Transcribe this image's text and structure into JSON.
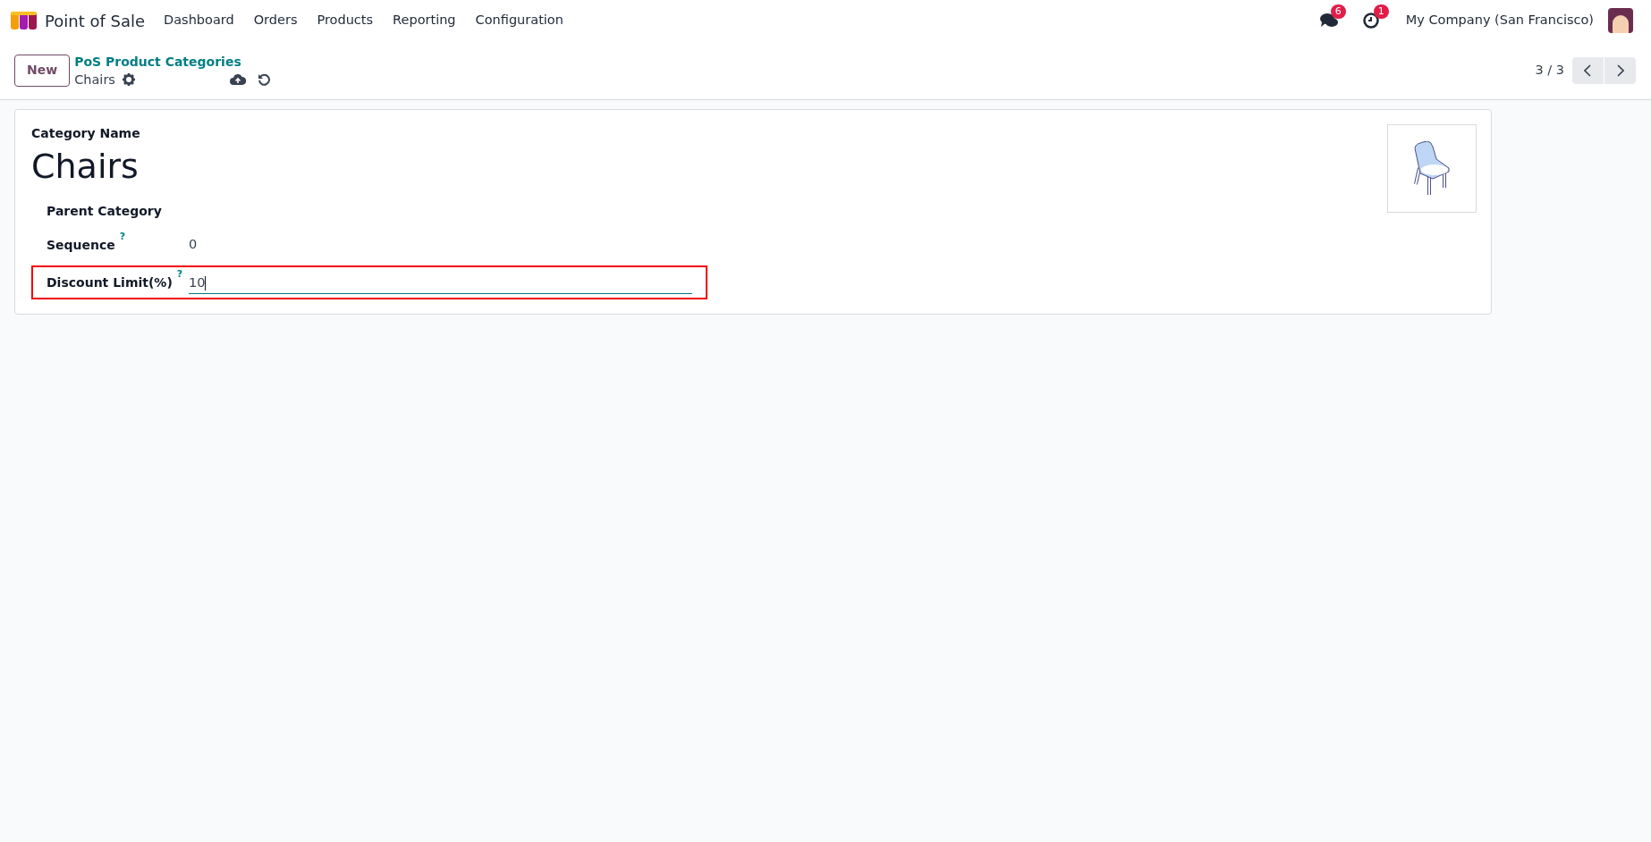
{
  "app": {
    "name": "Point of Sale"
  },
  "menu": [
    "Dashboard",
    "Orders",
    "Products",
    "Reporting",
    "Configuration"
  ],
  "systray": {
    "messages_badge": "6",
    "activities_badge": "1",
    "company": "My Company (San Francisco)"
  },
  "control_panel": {
    "new_button": "New",
    "breadcrumb": "PoS Product Categories",
    "record": "Chairs",
    "pager": "3 / 3"
  },
  "form": {
    "name_label": "Category Name",
    "name": "Chairs",
    "fields": [
      {
        "kind": "text",
        "label": "Parent Category",
        "highlighted": false
      },
      {
        "kind": "text",
        "label": "Sequence",
        "help": "?",
        "value": "0",
        "highlighted": false
      },
      {
        "kind": "input",
        "label": "Discount Limit(%)",
        "help": "?",
        "value": "10",
        "highlighted": true
      }
    ]
  }
}
